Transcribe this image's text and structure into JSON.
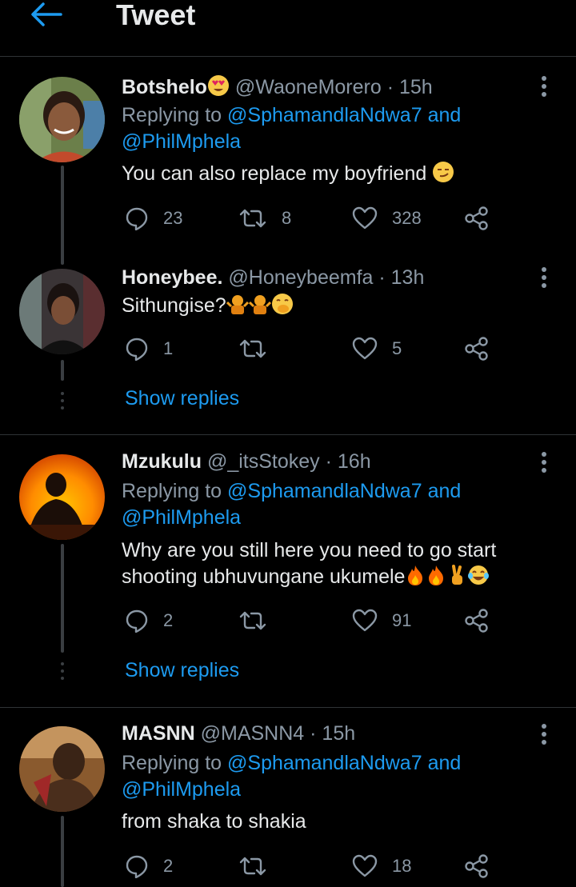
{
  "header": {
    "title": "Tweet"
  },
  "tweets": [
    {
      "name": "Botshelo",
      "handle": "@WaoneMorero",
      "time": "· 15h",
      "replying_prefix": "Replying to",
      "mention1": "@SphamandlaNdwa7",
      "and": "and",
      "mention2": "@PhilMphela",
      "text": "You can also replace my boyfriend",
      "replies": "23",
      "retweets": "8",
      "likes": "328"
    },
    {
      "name": "Honeybee.",
      "handle": "@Honeybeemfa",
      "time": "· 13h",
      "text": "Sithungise?",
      "replies": "1",
      "retweets": "",
      "likes": "5",
      "show_replies": "Show replies"
    },
    {
      "name": "Mzukulu",
      "handle": "@_itsStokey",
      "time": "· 16h",
      "replying_prefix": "Replying to",
      "mention1": "@SphamandlaNdwa7",
      "and": "and",
      "mention2": "@PhilMphela",
      "text_line1": "Why are you still here you need to go start",
      "text_line2": "shooting ubhuvungane ukumele",
      "replies": "2",
      "retweets": "",
      "likes": "91",
      "show_replies": "Show replies"
    },
    {
      "name": "MASNN",
      "handle": "@MASNN4",
      "time": "· 15h",
      "replying_prefix": "Replying to",
      "mention1": "@SphamandlaNdwa7",
      "and": "and",
      "mention2": "@PhilMphela",
      "text": "from shaka to shakia",
      "replies": "2",
      "retweets": "",
      "likes": "18"
    }
  ],
  "colors": {
    "accent": "#1d9bf0",
    "muted": "#8b98a5",
    "text": "#e7e9ea",
    "background": "#000000"
  }
}
